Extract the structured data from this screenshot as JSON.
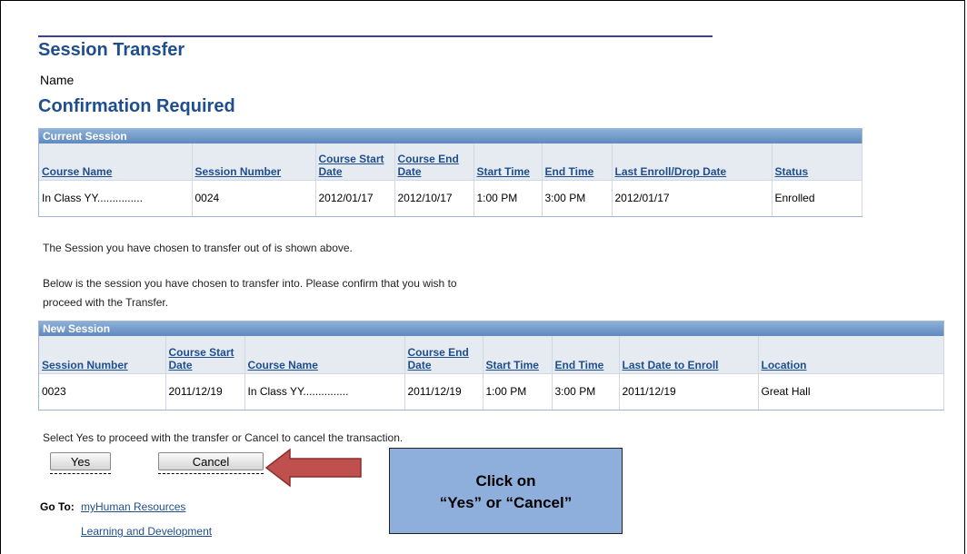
{
  "page": {
    "title": "Session Transfer",
    "name_label": "Name",
    "confirm_title": "Confirmation Required"
  },
  "current_session": {
    "header": "Current Session",
    "columns": [
      "Course Name",
      "Session Number",
      "Course Start Date",
      "Course End Date",
      "Start Time",
      "End Time",
      "Last Enroll/Drop Date",
      "Status"
    ],
    "row": [
      "In Class YY...............",
      "0024",
      "2012/01/17",
      "2012/10/17",
      "1:00 PM",
      "3:00 PM",
      "2012/01/17",
      "Enrolled"
    ]
  },
  "info": {
    "line1": "The Session you have chosen to transfer out of is shown above.",
    "line2": "Below is the session you have chosen to transfer into. Please confirm that you wish to",
    "line3": "proceed with the Transfer."
  },
  "new_session": {
    "header": "New Session",
    "columns": [
      "Session Number",
      "Course Start Date",
      "Course Name",
      "Course End Date",
      "Start Time",
      "End Time",
      "Last Date to Enroll",
      "Location"
    ],
    "row": [
      "0023",
      "2011/12/19",
      "In Class YY...............",
      "2011/12/19",
      "1:00 PM",
      "3:00 PM",
      "2011/12/19",
      "Great Hall"
    ]
  },
  "actions": {
    "instruction": "Select Yes to proceed with the transfer or Cancel to cancel the transaction.",
    "yes_label": "Yes",
    "cancel_label": "Cancel"
  },
  "goto": {
    "label": "Go To:",
    "links": [
      "myHuman Resources",
      "Learning and Development"
    ]
  },
  "callout": {
    "line1": "Click on",
    "line2": "“Yes” or “Cancel”"
  },
  "colors": {
    "title": "#1f4e8c",
    "grid_header": "#6d95c6",
    "callout": "#8eaedb",
    "arrow": "#c0504d"
  }
}
